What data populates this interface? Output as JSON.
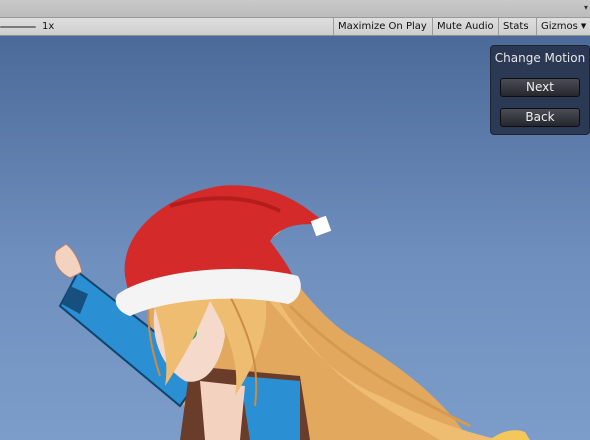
{
  "toolbar": {
    "scale_label": "1x",
    "maximize_label": "Maximize On Play",
    "mute_label": "Mute Audio",
    "stats_label": "Stats",
    "gizmos_label": "Gizmos"
  },
  "motion_panel": {
    "title": "Change Motion",
    "next_label": "Next",
    "back_label": "Back"
  },
  "colors": {
    "sky_top": "#4b6a98",
    "sky_bottom": "#7c9cc9",
    "hat_red": "#d42a2a",
    "hair_blonde": "#e8b266",
    "sleeve_blue": "#2b8fd3"
  }
}
